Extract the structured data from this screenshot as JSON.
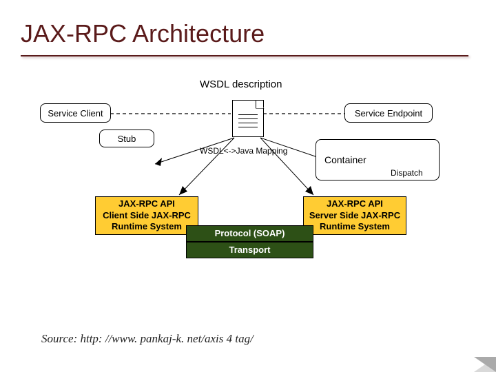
{
  "title": "JAX-RPC Architecture",
  "labels": {
    "wsdl_description": "WSDL description",
    "wsdl_java_mapping": "WSDL<->Java Mapping",
    "dispatch": "Dispatch"
  },
  "boxes": {
    "service_client": "Service Client",
    "stub": "Stub",
    "service_endpoint": "Service Endpoint",
    "container": "Container",
    "client_runtime": "JAX-RPC API\nClient Side JAX-RPC\nRuntime System",
    "server_runtime": "JAX-RPC API\nServer Side JAX-RPC\nRuntime System",
    "protocol": "Protocol (SOAP)",
    "transport": "Transport"
  },
  "source": "Source: http: //www. pankaj-k. net/axis 4 tag/"
}
